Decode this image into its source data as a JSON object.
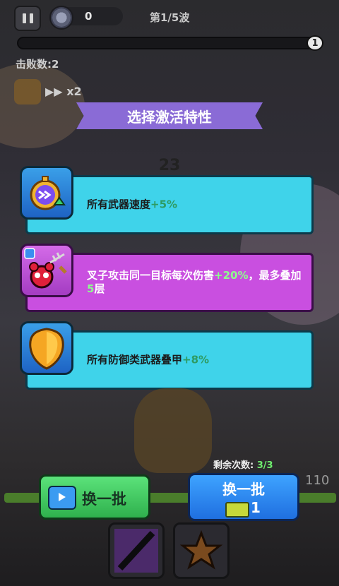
{
  "hud": {
    "coin_count": "0",
    "wave": "第1/5波",
    "progress_end": "1",
    "kills": "击败数:2",
    "speed": "x2"
  },
  "banner": {
    "title": "选择激活特性"
  },
  "counter": "23",
  "cards": [
    {
      "text": "所有武器速度",
      "bonus": "+5%",
      "tail": "",
      "color": "#3fd3ea"
    },
    {
      "text": "叉子攻击同一目标每次伤害",
      "bonus": "+20%",
      "tail": "，最多叠加",
      "tail_bonus": "5",
      "tail_end": "层",
      "color": "#c94fe0"
    },
    {
      "text": "所有防御类武器叠甲",
      "bonus": "+8%",
      "tail": "",
      "color": "#3fd3ea"
    }
  ],
  "remaining": {
    "label": "剩余次数:",
    "value": "3/3"
  },
  "hp_value": "110",
  "buttons": {
    "reroll_ad_label": "换一批",
    "reroll_paid_label": "换一批",
    "reroll_paid_cost": "1"
  },
  "icons": {
    "pause": "pause-icon",
    "coin": "coin-icon",
    "speed": "fast-forward-icon",
    "card1": "stopwatch-speed-icon",
    "card2": "fork-skull-icon",
    "card3": "shield-icon",
    "ad": "video-ad-icon",
    "ticket": "ticket-icon"
  }
}
